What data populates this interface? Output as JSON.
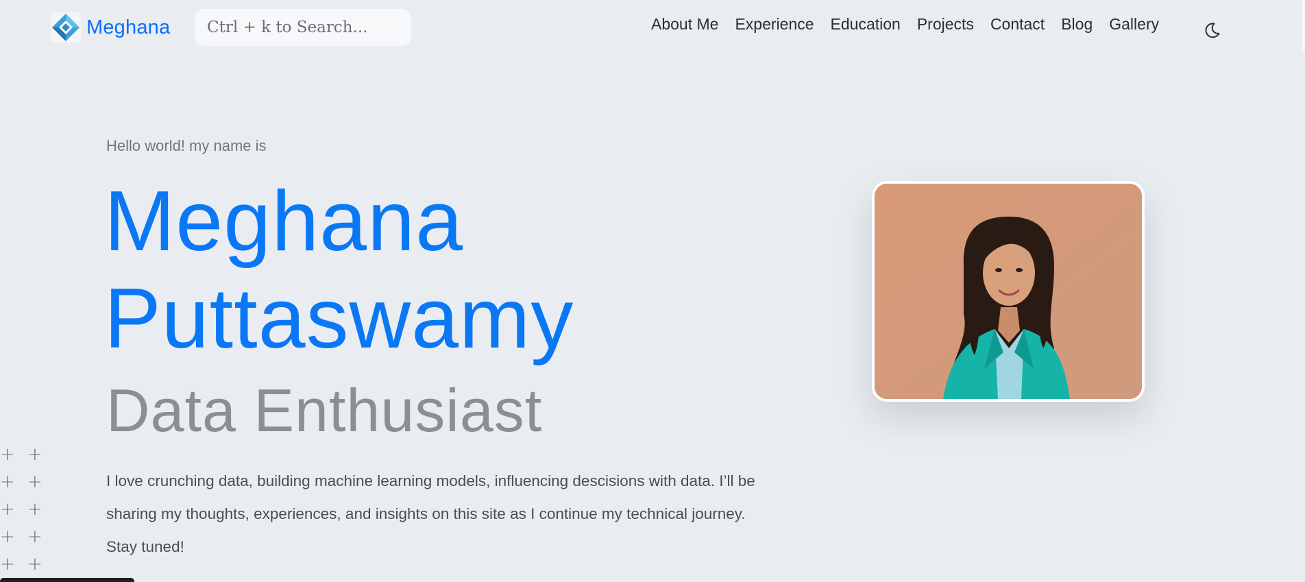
{
  "brand": {
    "name": "Meghana",
    "color": "#0d6efd"
  },
  "search": {
    "placeholder": "Ctrl + k to Search..."
  },
  "nav": {
    "items": [
      "About Me",
      "Experience",
      "Education",
      "Projects",
      "Contact",
      "Blog",
      "Gallery"
    ],
    "theme_icon": "moon-icon"
  },
  "hero": {
    "greeting": "Hello world! my name is",
    "first_name": "Meghana",
    "last_name": "Puttaswamy",
    "role": "Data Enthusiast",
    "bio": "I love crunching data, building machine learning models, influencing descisions with data. I’ll be sharing my thoughts, experiences, and insights on this site as I continue my technical journey. Stay tuned!",
    "accent_color": "#0a78f5",
    "muted_color": "#8b8e92"
  },
  "portrait": {
    "alt": "profile-photo"
  },
  "decor": {
    "plus_icon": "plus-icon"
  }
}
